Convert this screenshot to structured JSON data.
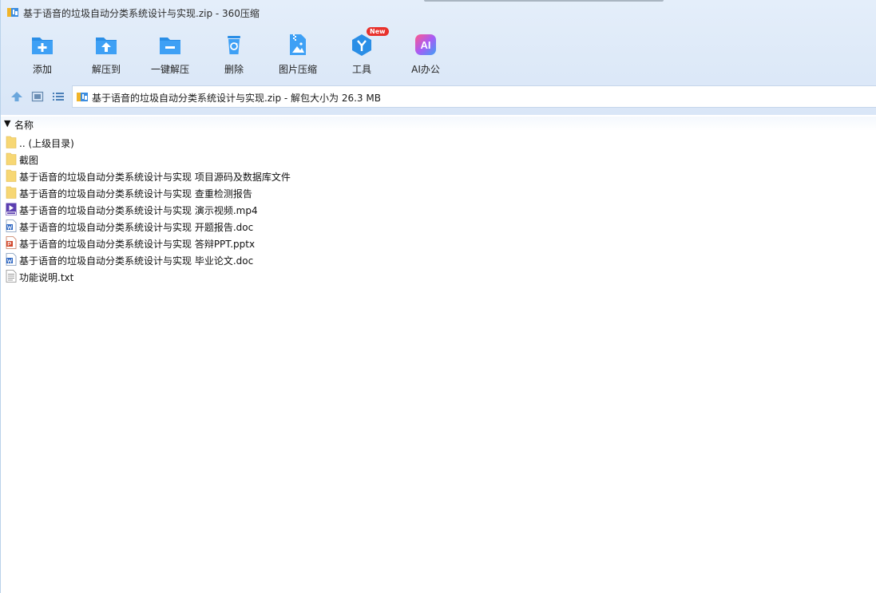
{
  "window": {
    "title": "基于语音的垃圾自动分类系统设计与实现.zip - 360压缩"
  },
  "toolbar": {
    "items": [
      {
        "label": "添加",
        "icon": "add-folder-icon"
      },
      {
        "label": "解压到",
        "icon": "extract-to-icon"
      },
      {
        "label": "一键解压",
        "icon": "one-click-extract-icon"
      },
      {
        "label": "删除",
        "icon": "recycle-bin-icon"
      },
      {
        "label": "图片压缩",
        "icon": "image-compress-icon"
      },
      {
        "label": "工具",
        "icon": "tools-icon",
        "badge": "New"
      },
      {
        "label": "AI办公",
        "icon": "ai-office-icon",
        "icon_text": "AI"
      }
    ]
  },
  "address_bar": {
    "path": "基于语音的垃圾自动分类系统设计与实现.zip - 解包大小为 26.3 MB"
  },
  "file_list": {
    "column_name": "名称",
    "sort_indicator": "▼",
    "rows": [
      {
        "name": ".. (上级目录)",
        "type": "folder"
      },
      {
        "name": "截图",
        "type": "folder"
      },
      {
        "name": "基于语音的垃圾自动分类系统设计与实现 项目源码及数据库文件",
        "type": "folder"
      },
      {
        "name": "基于语音的垃圾自动分类系统设计与实现 查重检测报告",
        "type": "folder"
      },
      {
        "name": "基于语音的垃圾自动分类系统设计与实现 演示视频.mp4",
        "type": "video"
      },
      {
        "name": "基于语音的垃圾自动分类系统设计与实现 开题报告.doc",
        "type": "word"
      },
      {
        "name": "基于语音的垃圾自动分类系统设计与实现 答辩PPT.pptx",
        "type": "ppt"
      },
      {
        "name": "基于语音的垃圾自动分类系统设计与实现 毕业论文.doc",
        "type": "word"
      },
      {
        "name": "功能说明.txt",
        "type": "text"
      }
    ]
  },
  "colors": {
    "accent": "#2a8ee6",
    "folder": "#f7d774",
    "badge": "#e8322d"
  }
}
